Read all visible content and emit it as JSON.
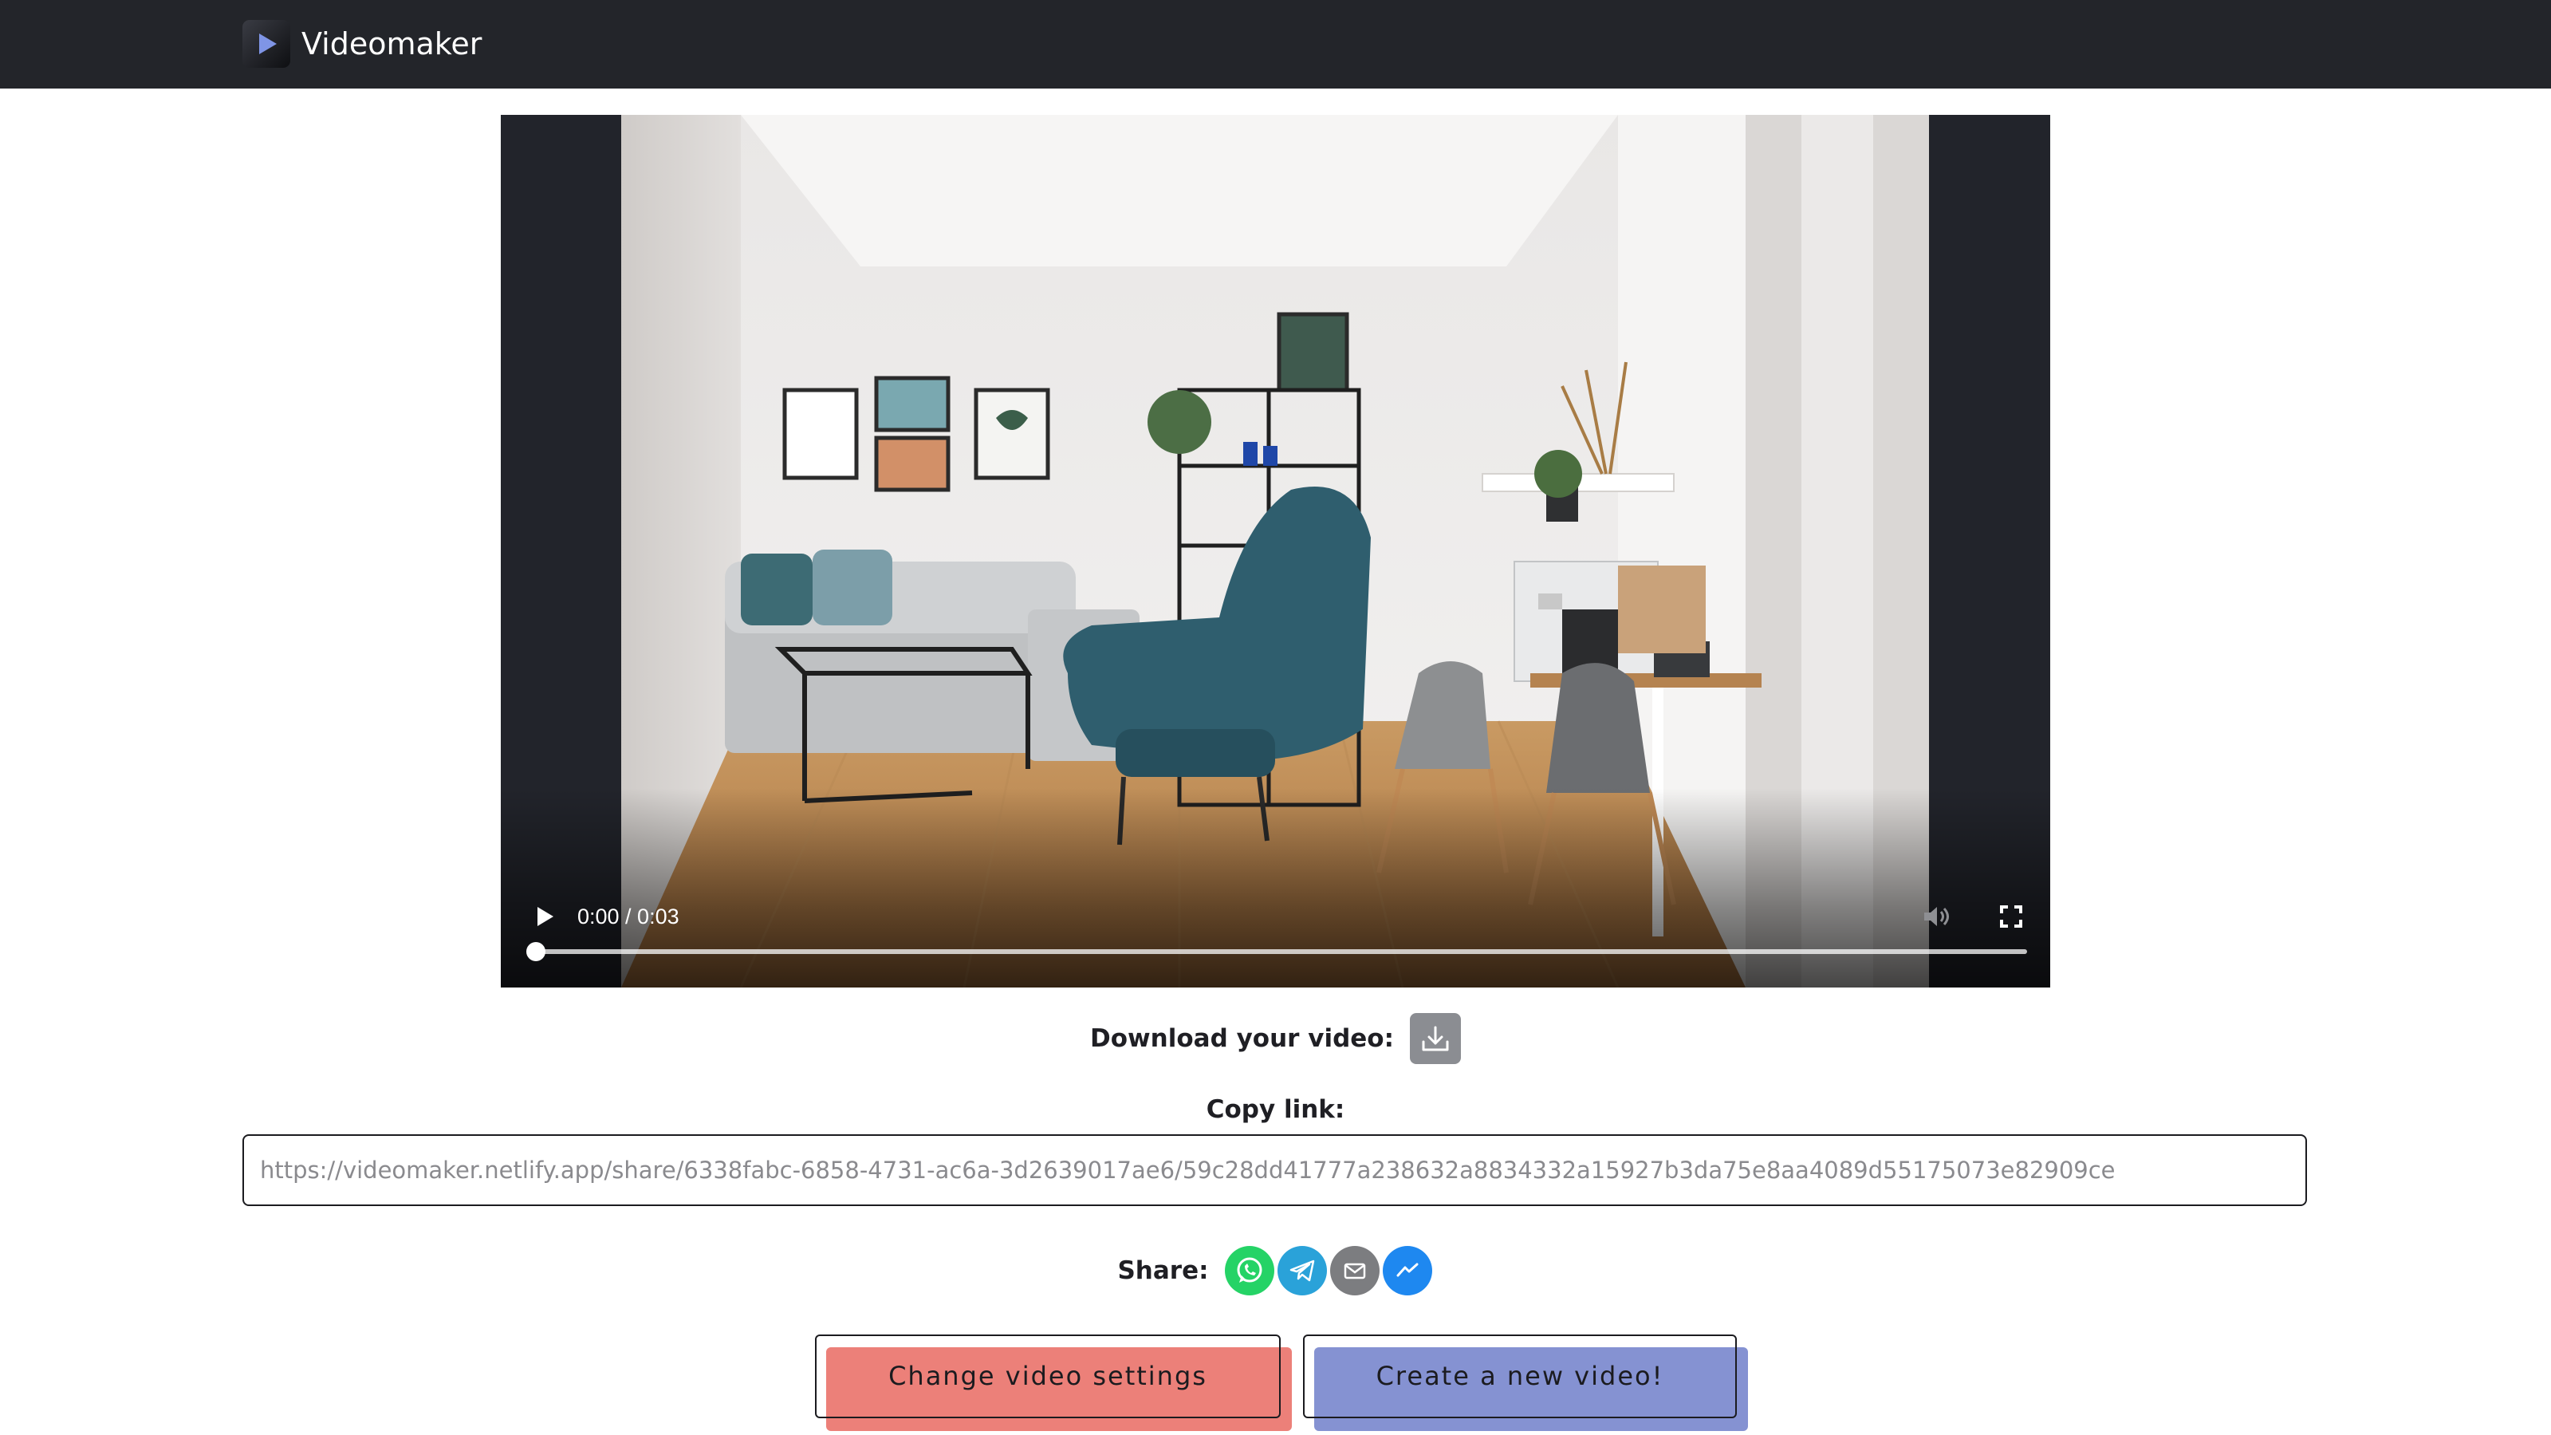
{
  "header": {
    "app_name": "Videomaker",
    "logo_icon": "play-logo-icon"
  },
  "player": {
    "time_display": "0:00 / 0:03",
    "progress": 0,
    "controls": [
      "play-icon",
      "volume-icon",
      "fullscreen-icon"
    ]
  },
  "download": {
    "label": "Download your video:",
    "icon": "download-icon"
  },
  "copy_link": {
    "label": "Copy link:",
    "url": "https://videomaker.netlify.app/share/6338fabc-6858-4731-ac6a-3d2639017ae6/59c28dd41777a238632a8834332a15927b3da75e8aa4089d55175073e82909ce"
  },
  "share": {
    "label": "Share:",
    "targets": [
      "whatsapp-icon",
      "telegram-icon",
      "email-icon",
      "messenger-icon"
    ]
  },
  "actions": {
    "change_settings": "Change video settings",
    "create_new": "Create a new video!"
  },
  "colors": {
    "header_bg": "#23252a",
    "player_bg": "#22242b",
    "change_button_accent": "#ec8079",
    "create_button_accent": "#8592d2",
    "whatsapp": "#25d366",
    "telegram": "#2aa2d9",
    "email": "#7c7d80",
    "messenger": "#1e88f0"
  }
}
